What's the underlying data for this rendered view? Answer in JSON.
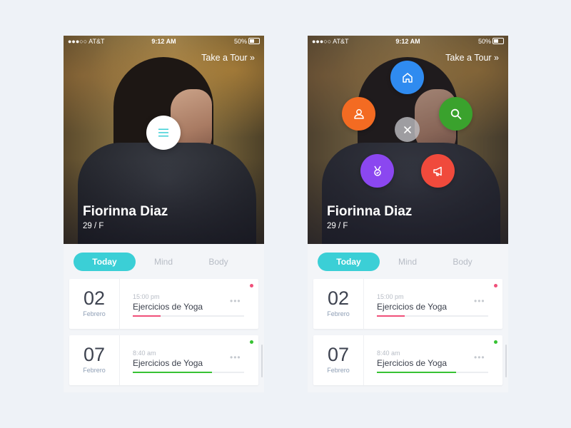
{
  "status": {
    "carrier": "●●●○○ AT&T",
    "time": "9:12 AM",
    "battery": "50%"
  },
  "header": {
    "tour_label": "Take a Tour »"
  },
  "profile": {
    "name": "Fiorinna Diaz",
    "age": "29 / F"
  },
  "tabs": [
    {
      "label": "Today",
      "active": true
    },
    {
      "label": "Mind",
      "active": false
    },
    {
      "label": "Body",
      "active": false
    }
  ],
  "events": [
    {
      "day": "02",
      "month": "Febrero",
      "time": "15:00 pm",
      "title": "Ejercicios de Yoga",
      "more": "•••",
      "progress": 0.25,
      "color": "#f0507a"
    },
    {
      "day": "07",
      "month": "Febrero",
      "time": "8:40 am",
      "title": "Ejercicios de Yoga",
      "more": "•••",
      "progress": 0.71,
      "color": "#37c233"
    }
  ],
  "radial_menu": [
    {
      "icon": "home-icon",
      "color": "#2f8bf0"
    },
    {
      "icon": "user-icon",
      "color": "#f36b22"
    },
    {
      "icon": "search-icon",
      "color": "#3aa22d"
    },
    {
      "icon": "close-icon",
      "color": "#bebec3"
    },
    {
      "icon": "medal-icon",
      "color": "#8b47f0"
    },
    {
      "icon": "megaphone-icon",
      "color": "#f04a3c"
    }
  ],
  "colors": {
    "accent": "#3bcfd6",
    "menu_icon": "#3bcfd6"
  }
}
